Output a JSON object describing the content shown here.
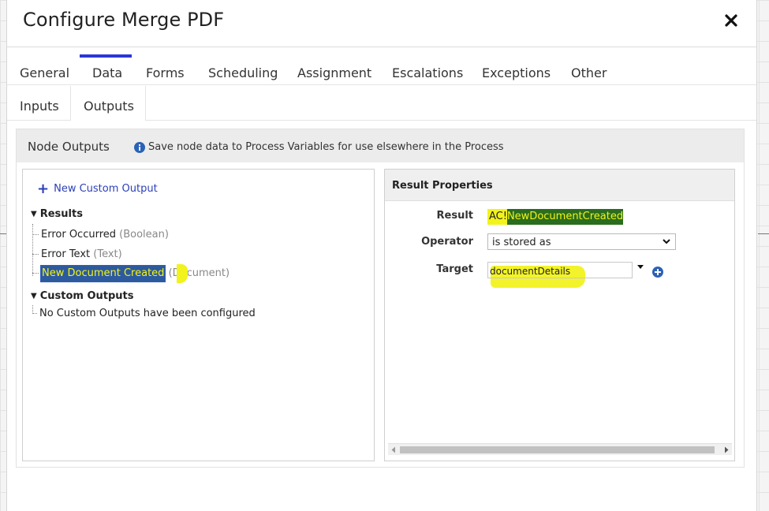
{
  "dialog": {
    "title": "Configure Merge PDF"
  },
  "tabs": [
    {
      "label": "General",
      "active": false
    },
    {
      "label": "Data",
      "active": true
    },
    {
      "label": "Forms",
      "active": false
    },
    {
      "label": "Scheduling",
      "active": false
    },
    {
      "label": "Assignment",
      "active": false
    },
    {
      "label": "Escalations",
      "active": false
    },
    {
      "label": "Exceptions",
      "active": false
    },
    {
      "label": "Other",
      "active": false
    }
  ],
  "subtabs": [
    {
      "label": "Inputs",
      "active": false
    },
    {
      "label": "Outputs",
      "active": true
    }
  ],
  "node_outputs": {
    "title": "Node Outputs",
    "info": "Save node data to Process Variables for use elsewhere in the Process"
  },
  "left_pane": {
    "new_output_label": "New Custom Output",
    "results_label": "Results",
    "results": [
      {
        "name": "Error Occurred",
        "type": "(Boolean)"
      },
      {
        "name": "Error Text",
        "type": "(Text)"
      },
      {
        "name": "New Document Created",
        "type": "(Document)"
      }
    ],
    "custom_outputs_label": "Custom Outputs",
    "custom_outputs_empty": "No Custom Outputs have been configured"
  },
  "result_properties": {
    "title": "Result Properties",
    "result_label": "Result",
    "result_prefix": "AC!",
    "result_value": "NewDocumentCreated",
    "operator_label": "Operator",
    "operator_value": "is stored as",
    "target_label": "Target",
    "target_value": "documentDetails"
  },
  "colors": {
    "tab_accent": "#2a36d9",
    "highlight_yellow": "#f2f214",
    "selection_blue": "#2e5ebd",
    "link_blue": "#2b3fb8"
  }
}
